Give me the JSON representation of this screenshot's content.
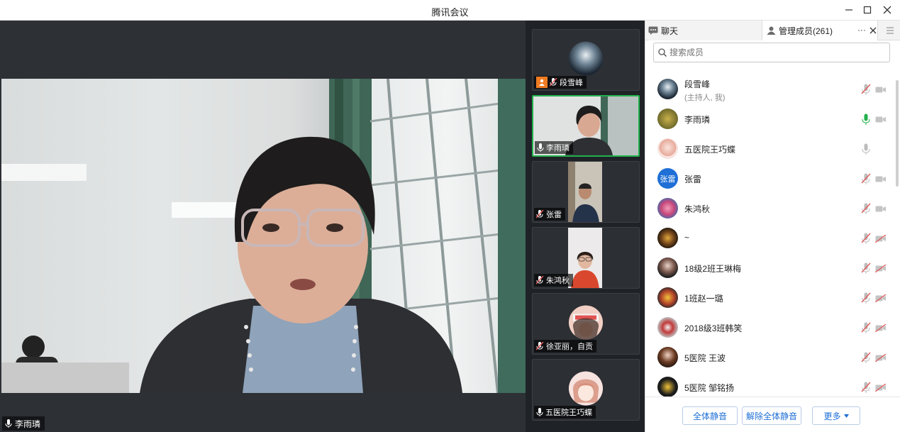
{
  "window": {
    "title": "腾讯会议"
  },
  "main_video": {
    "speaker_label": "李雨璘"
  },
  "thumbnails": [
    {
      "label": "段雪峰",
      "mic": "muted",
      "host": true
    },
    {
      "label": "李雨璘",
      "mic": "on",
      "active": true
    },
    {
      "label": "张雷",
      "mic": "muted"
    },
    {
      "label": "朱鸿秋",
      "mic": "muted"
    },
    {
      "label": "徐亚丽，自贡",
      "mic": "muted"
    },
    {
      "label": "五医院王巧蝶",
      "mic": "on"
    }
  ],
  "panel": {
    "tab_chat": "聊天",
    "tab_members": "管理成员(261)",
    "more": "···",
    "search_placeholder": "搜索成员",
    "members": [
      {
        "name": "段雪峰",
        "sub": "(主持人, 我)",
        "mic": "muted",
        "cam": "off"
      },
      {
        "name": "李雨璘",
        "sub": "",
        "mic": "speaking",
        "cam": "off"
      },
      {
        "name": "五医院王巧蝶",
        "sub": "",
        "mic": "on",
        "cam": "none"
      },
      {
        "name": "张雷",
        "sub": "",
        "mic": "muted",
        "cam": "off",
        "avatar_text": "张雷"
      },
      {
        "name": "朱鸿秋",
        "sub": "",
        "mic": "muted",
        "cam": "off"
      },
      {
        "name": "~",
        "sub": "",
        "mic": "muted",
        "cam": "disabled"
      },
      {
        "name": "18级2班王琳梅",
        "sub": "",
        "mic": "muted",
        "cam": "disabled"
      },
      {
        "name": "1班赵一璐",
        "sub": "",
        "mic": "muted",
        "cam": "disabled"
      },
      {
        "name": "2018级3班韩笑",
        "sub": "",
        "mic": "muted",
        "cam": "disabled"
      },
      {
        "name": "5医院  王波",
        "sub": "",
        "mic": "muted",
        "cam": "disabled"
      },
      {
        "name": "5医院 邹铭扬",
        "sub": "",
        "mic": "muted",
        "cam": "disabled"
      }
    ],
    "footer": {
      "mute_all": "全体静音",
      "unmute_all": "解除全体静音",
      "more": "更多"
    }
  },
  "colors": {
    "accent": "#1f6fd6",
    "speaking": "#22b14c",
    "muted": "#e05a5a",
    "dark_bg": "#2d3035"
  }
}
